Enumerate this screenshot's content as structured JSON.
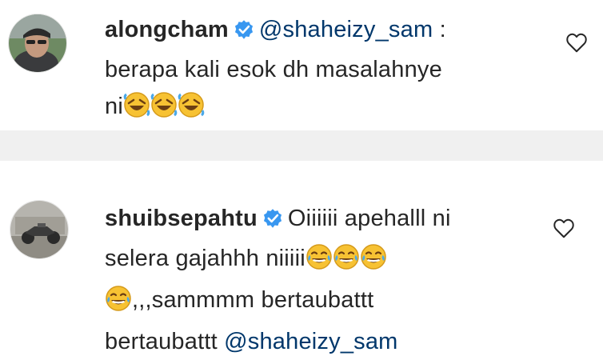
{
  "comments": [
    {
      "username": "alongcham",
      "verified": true,
      "mention": "@shaheizy_sam",
      "text_after_mention": " :",
      "line2": "berapa kali esok dh masalahnye",
      "line3_text": "ni",
      "line3_emojis": [
        "rolling-on-floor-laughing-icon",
        "rolling-on-floor-laughing-icon",
        "rolling-on-floor-laughing-icon"
      ],
      "liked": false
    },
    {
      "username": "shuibsepahtu",
      "verified": true,
      "line1_text": "Oiiiiii apehalll ni",
      "line2_text": "selera gajahhh niiiii",
      "line2_emojis": [
        "tears-of-joy-icon",
        "tears-of-joy-icon",
        "tears-of-joy-icon"
      ],
      "line3_emoji": "tears-of-joy-icon",
      "line3_text": ",,,sammmm bertaubattt",
      "line4_text": "bertaubattt ",
      "line4_mention": "@shaheizy_sam",
      "liked": false
    }
  ],
  "colors": {
    "text": "#262626",
    "mention": "#00376b",
    "verified_badge": "#3897f0",
    "separator": "#f0f0f0",
    "emoji_face": "#f7c233"
  }
}
